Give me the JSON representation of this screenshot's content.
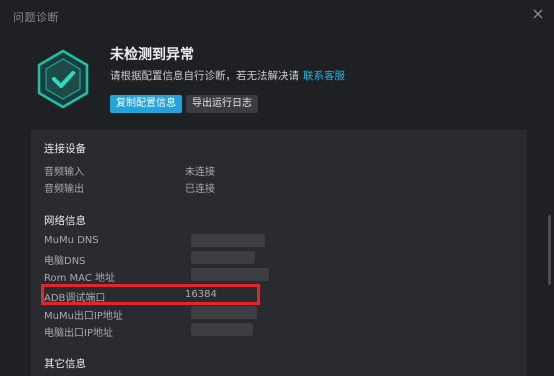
{
  "window": {
    "title": "问题诊断"
  },
  "status": {
    "title": "未检测到异常",
    "subtitle": "请根据配置信息自行诊断，若无法解决请",
    "support_link": "联系客服",
    "icon": "shield-check-icon"
  },
  "actions": {
    "copy_config": "复制配置信息",
    "export_log": "导出运行日志"
  },
  "sections": {
    "devices": {
      "title": "连接设备",
      "rows": [
        {
          "label": "音频输入",
          "value": "未连接"
        },
        {
          "label": "音频输出",
          "value": "已连接"
        }
      ]
    },
    "network": {
      "title": "网络信息",
      "rows": [
        {
          "label": "MuMu DNS",
          "value": ""
        },
        {
          "label": "电脑DNS",
          "value": ""
        },
        {
          "label": "Rom MAC 地址",
          "value": ""
        },
        {
          "label": "ADB调试端口",
          "value": "16384"
        },
        {
          "label": "MuMu出口IP地址",
          "value": ""
        },
        {
          "label": "电脑出口IP地址",
          "value": ""
        }
      ]
    },
    "other": {
      "title": "其它信息"
    }
  },
  "colors": {
    "accent": "#22a3dc",
    "link": "#21b4e8",
    "highlight": "#e6242c",
    "shield": "#19c3a9"
  }
}
